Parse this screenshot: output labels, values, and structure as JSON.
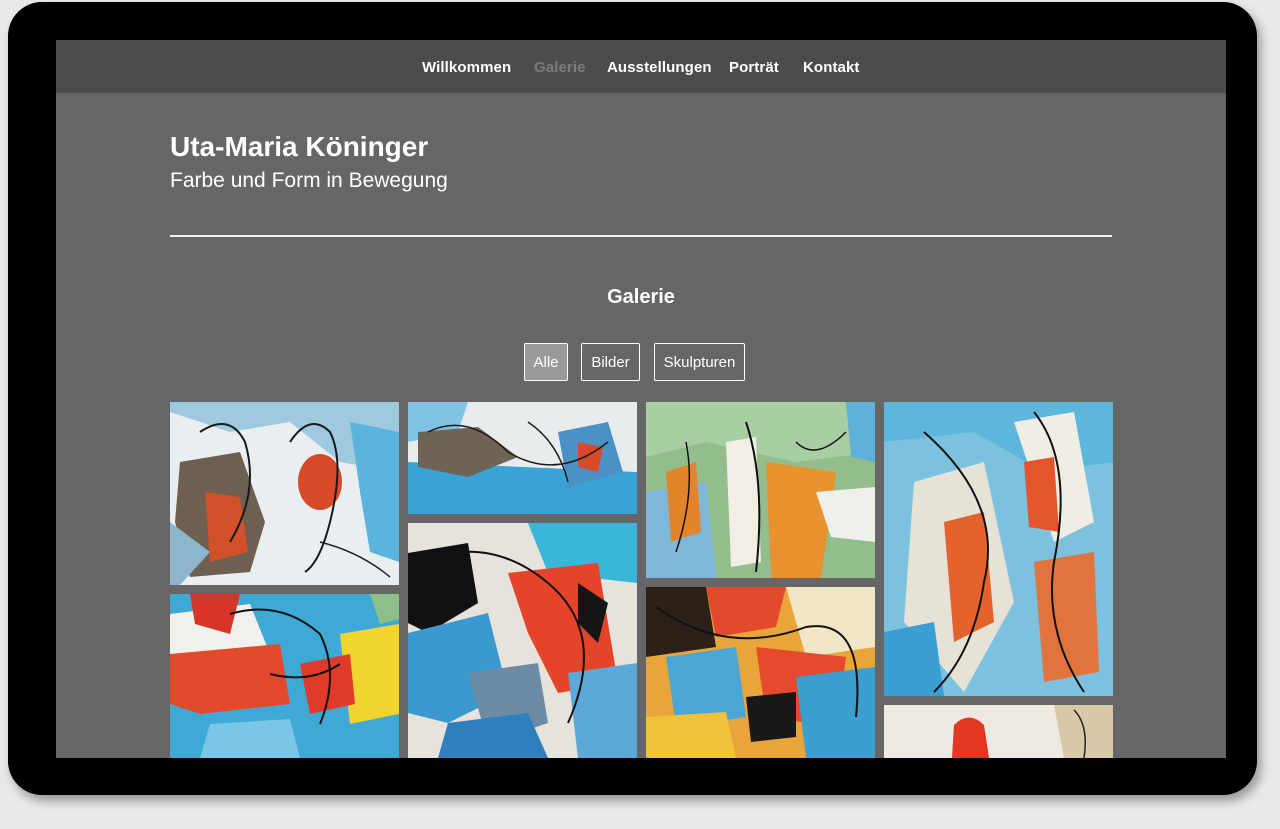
{
  "nav": {
    "items": [
      {
        "label": "Willkommen",
        "active": false
      },
      {
        "label": "Galerie",
        "active": true
      },
      {
        "label": "Ausstellungen",
        "active": false
      },
      {
        "label": "Porträt",
        "active": false
      },
      {
        "label": "Kontakt",
        "active": false
      }
    ]
  },
  "header": {
    "title": "Uta-Maria Köninger",
    "subtitle": "Farbe und Form in Bewegung"
  },
  "gallery": {
    "heading": "Galerie",
    "filters": [
      {
        "label": "Alle",
        "active": true
      },
      {
        "label": "Bilder",
        "active": false
      },
      {
        "label": "Skulpturen",
        "active": false
      }
    ]
  },
  "colors": {
    "page_background": "#666666",
    "nav_background": "#4c4c4c",
    "nav_active_text": "#7c7c7c",
    "filter_active_background": "#9a9a9a"
  }
}
